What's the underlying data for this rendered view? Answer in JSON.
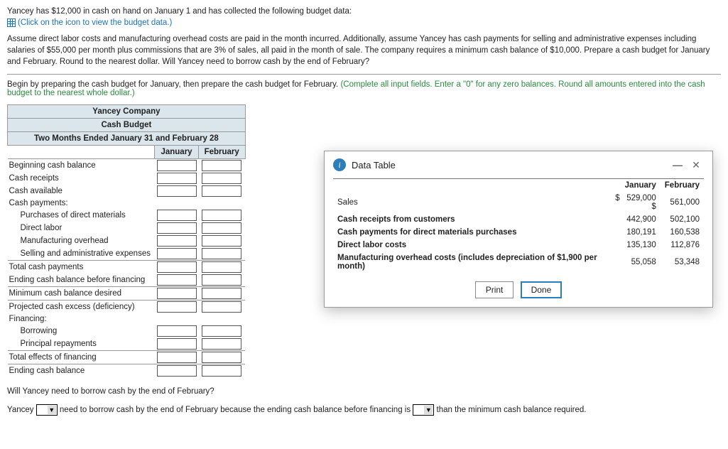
{
  "intro": {
    "line1": "Yancey has $12,000 in cash on hand on January 1 and has collected the following budget data:",
    "iconLink": "(Click on the icon to view the budget data.)",
    "para2": "Assume direct labor costs and manufacturing overhead costs are paid in the month incurred. Additionally, assume Yancey has cash payments for selling and administrative expenses including salaries of $55,000 per month plus commissions that are 3% of sales, all paid in the month of sale. The company requires a minimum cash balance of $10,000. Prepare a cash budget for January and February. Round to the nearest dollar. Will Yancey need to borrow cash by the end of February?",
    "instrBlack": "Begin by preparing the cash budget for January, then prepare the cash budget for February. ",
    "instrGreen": "(Complete all input fields. Enter a \"0\" for any zero balances. Round all amounts entered into the cash budget to the nearest whole dollar.)"
  },
  "budget": {
    "title1": "Yancey Company",
    "title2": "Cash Budget",
    "title3": "Two Months Ended January 31 and February 28",
    "col1": "January",
    "col2": "February",
    "rows": {
      "r1": "Beginning cash balance",
      "r2": "Cash receipts",
      "r3": "Cash available",
      "r4": "Cash payments:",
      "r5": "Purchases of direct materials",
      "r6": "Direct labor",
      "r7": "Manufacturing overhead",
      "r8": "Selling and administrative expenses",
      "r9": "Total cash payments",
      "r10": "Ending cash balance before financing",
      "r11": "Minimum cash balance desired",
      "r12": "Projected cash excess (deficiency)",
      "r13": "Financing:",
      "r14": "Borrowing",
      "r15": "Principal repayments",
      "r16": "Total effects of financing",
      "r17": "Ending cash balance"
    }
  },
  "dialog": {
    "title": "Data Table",
    "col0": "",
    "col1": "January",
    "col2": "February",
    "rows": [
      {
        "label": "Sales",
        "jan": "529,000",
        "feb": "561,000",
        "dollarJan": "$",
        "dollarFeb": "$",
        "bold": false
      },
      {
        "label": "Cash receipts from customers",
        "jan": "442,900",
        "feb": "502,100",
        "bold": true
      },
      {
        "label": "Cash payments for direct materials purchases",
        "jan": "180,191",
        "feb": "160,538",
        "bold": true
      },
      {
        "label": "Direct labor costs",
        "jan": "135,130",
        "feb": "112,876",
        "bold": true
      },
      {
        "label": "Manufacturing overhead costs (includes depreciation of $1,900 per month)",
        "jan": "55,058",
        "feb": "53,348",
        "bold": true
      }
    ],
    "print": "Print",
    "done": "Done"
  },
  "q2": {
    "question": "Will Yancey need to borrow cash by the end of February?",
    "pre": "Yancey ",
    "mid": " need to borrow cash by the end of February because the ending cash balance before financing is ",
    "post": " than the minimum cash balance required."
  }
}
